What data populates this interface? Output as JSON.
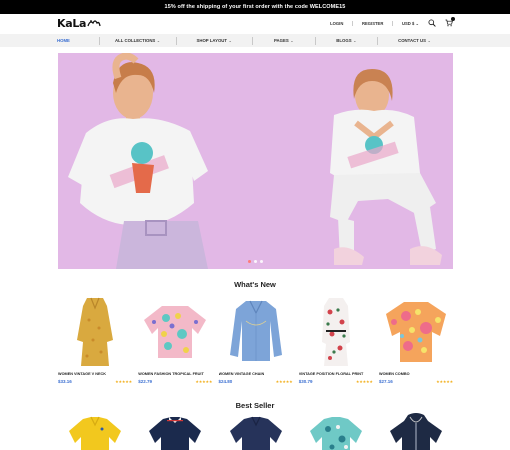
{
  "promo": {
    "text": "15% off the shipping of your first order with the code WELCOME15"
  },
  "header": {
    "logo_text": "KaLa",
    "login": "LOGIN",
    "register": "REGISTER",
    "currency": "USD $",
    "cart_count": ""
  },
  "nav": {
    "items": [
      {
        "label": "HOME",
        "active": true,
        "dropdown": false
      },
      {
        "label": "ALL COLLECTIONS",
        "dropdown": true
      },
      {
        "label": "SHOP LAYOUT",
        "dropdown": true
      },
      {
        "label": "PAGES",
        "dropdown": true
      },
      {
        "label": "BLOGS",
        "dropdown": true
      },
      {
        "label": "CONTACT US",
        "dropdown": true
      }
    ],
    "chevron": "⌄"
  },
  "hero": {
    "slide_count": 3,
    "active_slide": 1,
    "bg_color": "#e2b8e6"
  },
  "whats_new": {
    "title": "What's New",
    "products": [
      {
        "name": "WOMEN VINTAGE V NECK",
        "price": "$33.16",
        "stars": "★★★★★"
      },
      {
        "name": "WOMEN FASHION TROPICAL FRUIT",
        "price": "$22.79",
        "stars": "★★★★★"
      },
      {
        "name": "WOMEN VINTAGE CHAIN",
        "price": "$24.80",
        "stars": "★★★★★"
      },
      {
        "name": "VINTAGE POSITION FLORAL PRINT",
        "price": "$30.79",
        "stars": "★★★★★"
      },
      {
        "name": "WOMEN COMBO",
        "price": "$27.16",
        "stars": "★★★★★"
      }
    ]
  },
  "best_seller": {
    "title": "Best Seller"
  },
  "colors": {
    "accent": "#3b6fd1",
    "star": "#f2b01e",
    "promo_bg": "#000000",
    "nav_bg": "#f2f2f2"
  }
}
